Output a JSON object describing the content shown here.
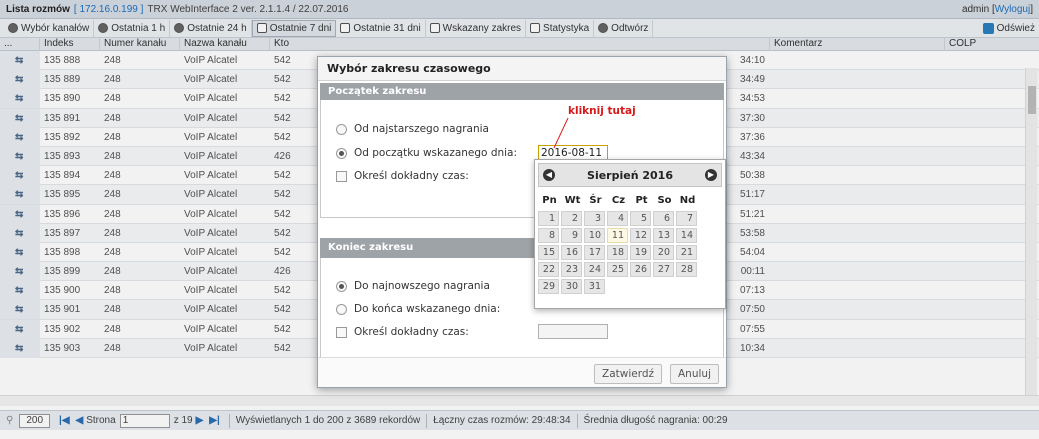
{
  "titlebar": {
    "app_name": "Lista rozmów",
    "ip": "[ 172.16.0.199 ]",
    "version": "TRX WebInterface 2 ver. 2.1.1.4 / 22.07.2016",
    "user": "admin [",
    "logout": "Wyloguj",
    "user_close": "]"
  },
  "toolbar": {
    "items": [
      {
        "label": "Wybór kanałów",
        "icon": "settings-icon"
      },
      {
        "label": "Ostatnia 1 h",
        "icon": "clock-icon"
      },
      {
        "label": "Ostatnie 24 h",
        "icon": "clock-icon"
      },
      {
        "label": "Ostatnie 7 dni",
        "icon": "calendar-icon"
      },
      {
        "label": "Ostatnie 31 dni",
        "icon": "calendar-icon"
      },
      {
        "label": "Wskazany zakres",
        "icon": "calendar-icon"
      },
      {
        "label": "Statystyka",
        "icon": "bar-chart-icon"
      },
      {
        "label": "Odtwórz",
        "icon": "play-icon"
      }
    ],
    "refresh": "Odśwież"
  },
  "grid": {
    "columns": [
      "...",
      "Indeks",
      "Numer kanału",
      "Nazwa kanału",
      "Kto",
      "Komentarz",
      "COLP"
    ],
    "rows": [
      {
        "index": "135 888",
        "channel": "248",
        "name": "VoIP Alcatel",
        "who": "542",
        "tail": "34:10"
      },
      {
        "index": "135 889",
        "channel": "248",
        "name": "VoIP Alcatel",
        "who": "542",
        "tail": "34:49"
      },
      {
        "index": "135 890",
        "channel": "248",
        "name": "VoIP Alcatel",
        "who": "542",
        "tail": "34:53"
      },
      {
        "index": "135 891",
        "channel": "248",
        "name": "VoIP Alcatel",
        "who": "542",
        "tail": "37:30"
      },
      {
        "index": "135 892",
        "channel": "248",
        "name": "VoIP Alcatel",
        "who": "542",
        "tail": "37:36"
      },
      {
        "index": "135 893",
        "channel": "248",
        "name": "VoIP Alcatel",
        "who": "426",
        "tail": "43:34"
      },
      {
        "index": "135 894",
        "channel": "248",
        "name": "VoIP Alcatel",
        "who": "542",
        "tail": "50:38"
      },
      {
        "index": "135 895",
        "channel": "248",
        "name": "VoIP Alcatel",
        "who": "542",
        "tail": "51:17"
      },
      {
        "index": "135 896",
        "channel": "248",
        "name": "VoIP Alcatel",
        "who": "542",
        "tail": "51:21"
      },
      {
        "index": "135 897",
        "channel": "248",
        "name": "VoIP Alcatel",
        "who": "542",
        "tail": "53:58"
      },
      {
        "index": "135 898",
        "channel": "248",
        "name": "VoIP Alcatel",
        "who": "542",
        "tail": "54:04"
      },
      {
        "index": "135 899",
        "channel": "248",
        "name": "VoIP Alcatel",
        "who": "426",
        "tail": "00:11"
      },
      {
        "index": "135 900",
        "channel": "248",
        "name": "VoIP Alcatel",
        "who": "542",
        "tail": "07:13"
      },
      {
        "index": "135 901",
        "channel": "248",
        "name": "VoIP Alcatel",
        "who": "542",
        "tail": "07:50"
      },
      {
        "index": "135 902",
        "channel": "248",
        "name": "VoIP Alcatel",
        "who": "542",
        "tail": "07:55"
      },
      {
        "index": "135 903",
        "channel": "248",
        "name": "VoIP Alcatel",
        "who": "542",
        "tail": "10:34"
      }
    ]
  },
  "footer": {
    "page_size": "200",
    "page_label": "Strona",
    "page_value": "1",
    "page_of": "z 19",
    "showing": "Wyświetlanych 1 do 200 z 3689 rekordów",
    "total_time": "Łączny czas rozmów: 29:48:34",
    "avg_time": "Średnia długość nagrania: 00:29"
  },
  "dialog": {
    "title": "Wybór zakresu czasowego",
    "start_section": "Początek zakresu",
    "start_opt_oldest": "Od najstarszego nagrania",
    "start_opt_day": "Od początku wskazanego dnia:",
    "start_date": "2016-08-11",
    "start_exact": "Określ dokładny czas:",
    "end_section": "Koniec zakresu",
    "end_opt_newest": "Do najnowszego nagrania",
    "end_opt_day": "Do końca wskazanego dnia:",
    "end_exact": "Określ dokładny czas:",
    "confirm": "Zatwierdź",
    "cancel": "Anuluj"
  },
  "annotation": "kliknij tutaj",
  "calendar": {
    "title": "Sierpień 2016",
    "weekdays": [
      "Pn",
      "Wt",
      "Śr",
      "Cz",
      "Pt",
      "So",
      "Nd"
    ],
    "weeks": [
      [
        "1",
        "2",
        "3",
        "4",
        "5",
        "6",
        "7"
      ],
      [
        "8",
        "9",
        "10",
        "11",
        "12",
        "13",
        "14"
      ],
      [
        "15",
        "16",
        "17",
        "18",
        "19",
        "20",
        "21"
      ],
      [
        "22",
        "23",
        "24",
        "25",
        "26",
        "27",
        "28"
      ],
      [
        "29",
        "30",
        "31",
        "",
        "",
        "",
        ""
      ]
    ],
    "today": "11"
  },
  "colors": {
    "accent": "#1e6fc0",
    "annotation": "#d61a1a",
    "section": "#9ea3a8"
  }
}
